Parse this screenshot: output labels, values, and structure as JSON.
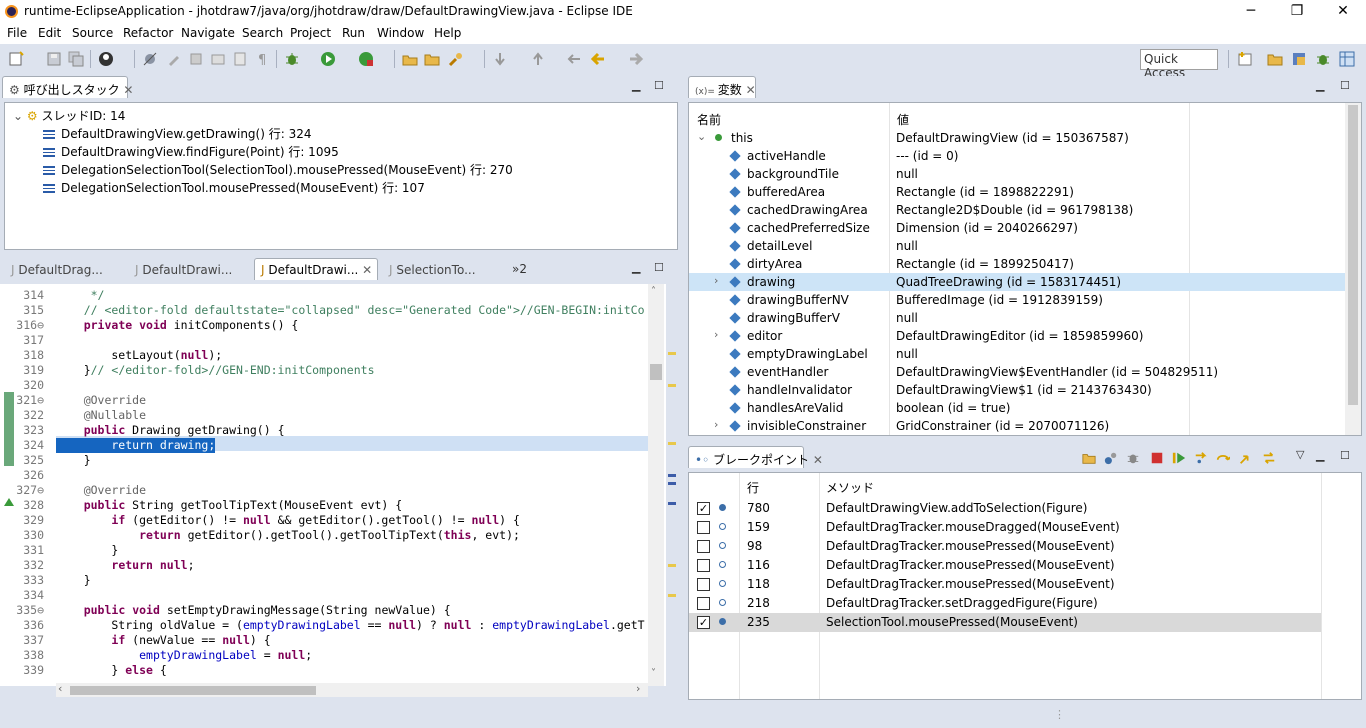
{
  "window": {
    "title": "runtime-EclipseApplication - jhotdraw7/java/org/jhotdraw/draw/DefaultDrawingView.java - Eclipse IDE",
    "minimize": "─",
    "restore": "❐",
    "close": "✕"
  },
  "menu": [
    "File",
    "Edit",
    "Source",
    "Refactor",
    "Navigate",
    "Search",
    "Project",
    "Run",
    "Window",
    "Help"
  ],
  "toolbar": {
    "quick_access": "Quick Access"
  },
  "callstack": {
    "tab_label": "呼び出しスタック",
    "thread": "スレッドID: 14",
    "frames": [
      "DefaultDrawingView.getDrawing() 行: 324",
      "DefaultDrawingView.findFigure(Point) 行: 1095",
      "DelegationSelectionTool(SelectionTool).mousePressed(MouseEvent) 行: 270",
      "DelegationSelectionTool.mousePressed(MouseEvent) 行: 107"
    ]
  },
  "editor": {
    "tabs": [
      "DefaultDrag...",
      "DefaultDrawi...",
      "DefaultDrawi...",
      "SelectionTo..."
    ],
    "overflow": "»2",
    "lines": [
      {
        "n": "314",
        "t": "     */"
      },
      {
        "n": "315",
        "t": "    // <editor-fold defaultstate=\"collapsed\" desc=\"Generated Code\">//GEN-BEGIN:initCo"
      },
      {
        "n": "316⊖",
        "t": "    private void initComponents() {"
      },
      {
        "n": "317",
        "t": ""
      },
      {
        "n": "318",
        "t": "        setLayout(null);"
      },
      {
        "n": "319",
        "t": "    }// </editor-fold>//GEN-END:initComponents"
      },
      {
        "n": "320",
        "t": ""
      },
      {
        "n": "321⊖",
        "t": "    @Override"
      },
      {
        "n": "322",
        "t": "    @Nullable"
      },
      {
        "n": "323",
        "t": "    public Drawing getDrawing() {"
      },
      {
        "n": "324",
        "t": "        return drawing;"
      },
      {
        "n": "325",
        "t": "    }"
      },
      {
        "n": "326",
        "t": ""
      },
      {
        "n": "327⊖",
        "t": "    @Override"
      },
      {
        "n": "328",
        "t": "    public String getToolTipText(MouseEvent evt) {"
      },
      {
        "n": "329",
        "t": "        if (getEditor() != null && getEditor().getTool() != null) {"
      },
      {
        "n": "330",
        "t": "            return getEditor().getTool().getToolTipText(this, evt);"
      },
      {
        "n": "331",
        "t": "        }"
      },
      {
        "n": "332",
        "t": "        return null;"
      },
      {
        "n": "333",
        "t": "    }"
      },
      {
        "n": "334",
        "t": ""
      },
      {
        "n": "335⊖",
        "t": "    public void setEmptyDrawingMessage(String newValue) {"
      },
      {
        "n": "336",
        "t": "        String oldValue = (emptyDrawingLabel == null) ? null : emptyDrawingLabel.getT"
      },
      {
        "n": "337",
        "t": "        if (newValue == null) {"
      },
      {
        "n": "338",
        "t": "            emptyDrawingLabel = null;"
      },
      {
        "n": "339",
        "t": "        } else {"
      }
    ]
  },
  "variables": {
    "tab_label": "変数",
    "col_name": "名前",
    "col_value": "値",
    "rows": [
      {
        "name": "this",
        "value": "DefaultDrawingView (id = 150367587)",
        "expand": "⌄",
        "root": true
      },
      {
        "name": "activeHandle",
        "value": "--- (id = 0)",
        "expand": ""
      },
      {
        "name": "backgroundTile",
        "value": "null",
        "expand": ""
      },
      {
        "name": "bufferedArea",
        "value": "Rectangle (id = 1898822291)",
        "expand": ""
      },
      {
        "name": "cachedDrawingArea",
        "value": "Rectangle2D$Double (id = 961798138)",
        "expand": ""
      },
      {
        "name": "cachedPreferredSize",
        "value": "Dimension (id = 2040266297)",
        "expand": ""
      },
      {
        "name": "detailLevel",
        "value": "null",
        "expand": ""
      },
      {
        "name": "dirtyArea",
        "value": "Rectangle (id = 1899250417)",
        "expand": ""
      },
      {
        "name": "drawing",
        "value": "QuadTreeDrawing (id = 1583174451)",
        "expand": "›",
        "selected": true
      },
      {
        "name": "drawingBufferNV",
        "value": "BufferedImage (id = 1912839159)",
        "expand": ""
      },
      {
        "name": "drawingBufferV",
        "value": "null",
        "expand": ""
      },
      {
        "name": "editor",
        "value": "DefaultDrawingEditor (id = 1859859960)",
        "expand": "›"
      },
      {
        "name": "emptyDrawingLabel",
        "value": "null",
        "expand": ""
      },
      {
        "name": "eventHandler",
        "value": "DefaultDrawingView$EventHandler (id = 504829511)",
        "expand": ""
      },
      {
        "name": "handleInvalidator",
        "value": "DefaultDrawingView$1 (id = 2143763430)",
        "expand": ""
      },
      {
        "name": "handlesAreValid",
        "value": "boolean (id = true)",
        "expand": ""
      },
      {
        "name": "invisibleConstrainer",
        "value": "GridConstrainer (id = 2070071126)",
        "expand": "›"
      }
    ]
  },
  "breakpoints": {
    "tab_label": "ブレークポイント",
    "col_line": "行",
    "col_method": "メソッド",
    "rows": [
      {
        "checked": true,
        "line": "780",
        "method": "DefaultDrawingView.addToSelection(Figure)"
      },
      {
        "checked": false,
        "line": "159",
        "method": "DefaultDragTracker.mouseDragged(MouseEvent)"
      },
      {
        "checked": false,
        "line": "98",
        "method": "DefaultDragTracker.mousePressed(MouseEvent)"
      },
      {
        "checked": false,
        "line": "116",
        "method": "DefaultDragTracker.mousePressed(MouseEvent)"
      },
      {
        "checked": false,
        "line": "118",
        "method": "DefaultDragTracker.mousePressed(MouseEvent)"
      },
      {
        "checked": false,
        "line": "218",
        "method": "DefaultDragTracker.setDraggedFigure(Figure)"
      },
      {
        "checked": true,
        "line": "235",
        "method": "SelectionTool.mousePressed(MouseEvent)",
        "selected": true
      }
    ]
  }
}
